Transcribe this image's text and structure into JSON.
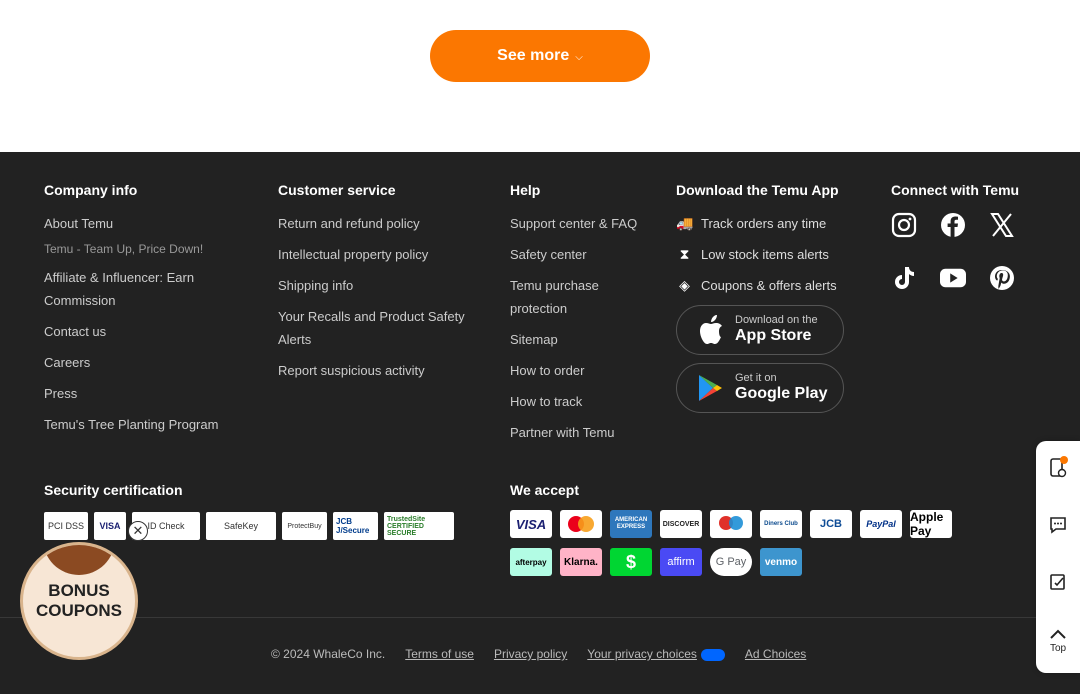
{
  "see_more": {
    "label": "See more"
  },
  "company": {
    "title": "Company info",
    "links": [
      "About Temu",
      "Affiliate & Influencer: Earn Commission",
      "Contact us",
      "Careers",
      "Press",
      "Temu's Tree Planting Program"
    ],
    "tagline": "Temu - Team Up, Price Down!"
  },
  "customer": {
    "title": "Customer service",
    "links": [
      "Return and refund policy",
      "Intellectual property policy",
      "Shipping info",
      "Your Recalls and Product Safety Alerts",
      "Report suspicious activity"
    ]
  },
  "help": {
    "title": "Help",
    "links": [
      "Support center & FAQ",
      "Safety center",
      "Temu purchase protection",
      "Sitemap",
      "How to order",
      "How to track",
      "Partner with Temu"
    ]
  },
  "app": {
    "title": "Download the Temu App",
    "features": [
      "Track orders any time",
      "Low stock items alerts",
      "Coupons & offers alerts"
    ],
    "app_store": {
      "small": "Download on the",
      "big": "App Store"
    },
    "google_play": {
      "small": "Get it on",
      "big": "Google Play"
    }
  },
  "connect": {
    "title": "Connect with Temu",
    "icons": [
      "instagram-icon",
      "facebook-icon",
      "x-icon",
      "tiktok-icon",
      "youtube-icon",
      "pinterest-icon"
    ]
  },
  "security": {
    "title": "Security certification",
    "badges": [
      "PCI DSS",
      "VISA",
      "ID Check",
      "SafeKey",
      "ProtectBuy",
      "JCB J/Secure",
      "TrustedSite CERTIFIED SECURE"
    ]
  },
  "payments": {
    "title": "We accept",
    "methods": [
      "VISA",
      "Mastercard",
      "AMERICAN EXPRESS",
      "DISCOVER",
      "Maestro",
      "Diners Club",
      "JCB",
      "PayPal",
      "Apple Pay",
      "afterpay",
      "Klarna.",
      "$",
      "affirm",
      "G Pay",
      "venmo"
    ]
  },
  "bottom": {
    "copyright": "© 2024 WhaleCo Inc.",
    "terms": "Terms of use",
    "privacy": "Privacy policy",
    "choices": "Your privacy choices",
    "ad": "Ad Choices"
  },
  "sidebar": {
    "top_label": "Top"
  },
  "bonus": {
    "line1": "BONUS",
    "line2": "COUPONS"
  },
  "colors": {
    "accent": "#fb7701",
    "footer_bg": "#222222"
  }
}
